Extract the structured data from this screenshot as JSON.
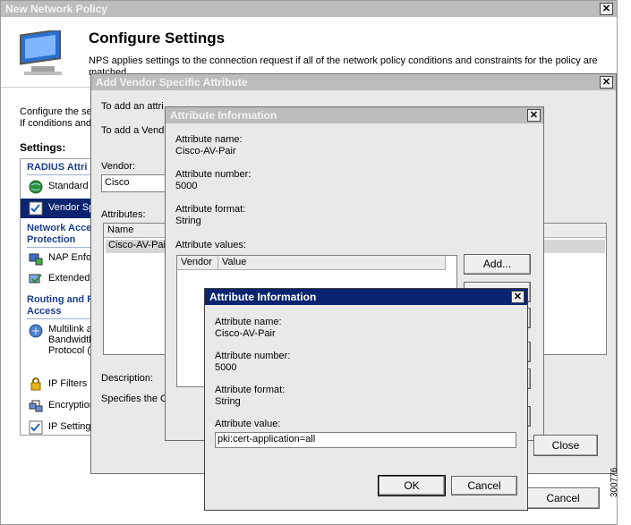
{
  "colors": {
    "active_title": "#0a2470",
    "inactive_title": "#bcbcbc",
    "dialog_bg": "#e9e9e9",
    "selection": "#0a2470"
  },
  "main_window": {
    "title": "New Network Policy",
    "heading": "Configure Settings",
    "description": "NPS applies settings to the connection request if all of the network policy conditions and constraints for the policy are matched.",
    "configure_text_1": "Configure the set",
    "configure_text_2": "If conditions and",
    "settings_label": "Settings:",
    "nav_groups": [
      {
        "title": "RADIUS Attri",
        "items": [
          {
            "label": "Standard",
            "icon": "globe-icon"
          },
          {
            "label": "Vendor Sp",
            "icon": "checklist-icon",
            "selected": true
          }
        ]
      },
      {
        "title_lines": [
          "Network Acce",
          "Protection"
        ],
        "items": [
          {
            "label": "NAP Enfo",
            "icon": "nap-icon"
          },
          {
            "label": "Extended",
            "icon": "extended-state-icon"
          }
        ]
      },
      {
        "title_lines": [
          "Routing and R",
          "Access"
        ],
        "items": [
          {
            "label_lines": [
              "Multilink a",
              "Bandwidth",
              "Protocol (I"
            ],
            "icon": "multilink-icon"
          },
          {
            "label": "IP Filters",
            "icon": "lock-icon"
          },
          {
            "label": "Encryption",
            "icon": "encryption-icon"
          },
          {
            "label": "IP Setting",
            "icon": "ip-settings-icon"
          }
        ]
      }
    ],
    "cancel_label": "Cancel"
  },
  "vendor_dialog": {
    "title": "Add Vendor Specific Attribute",
    "instruction_1": "To add an attri",
    "instruction_2": "To add a Vend",
    "vendor_label": "Vendor:",
    "vendor_value": "Cisco",
    "attributes_label": "Attributes:",
    "list_header": "Name",
    "list_items": [
      "Cisco-AV-Pai"
    ],
    "description_label": "Description:",
    "description_text": "Specifies the C",
    "close_label": "Close"
  },
  "attr_info_back": {
    "title": "Attribute Information",
    "name_label": "Attribute name:",
    "name_value": "Cisco-AV-Pair",
    "number_label": "Attribute number:",
    "number_value": "5000",
    "format_label": "Attribute format:",
    "format_value": "String",
    "values_label": "Attribute values:",
    "col_vendor": "Vendor",
    "col_value": "Value",
    "add_label": "Add..."
  },
  "attr_info_front": {
    "title": "Attribute Information",
    "name_label": "Attribute name:",
    "name_value": "Cisco-AV-Pair",
    "number_label": "Attribute number:",
    "number_value": "5000",
    "format_label": "Attribute format:",
    "format_value": "String",
    "value_label": "Attribute value:",
    "value_input": "pki:cert-application=all",
    "ok_label": "OK",
    "cancel_label": "Cancel"
  },
  "side_figure_number": "300776"
}
